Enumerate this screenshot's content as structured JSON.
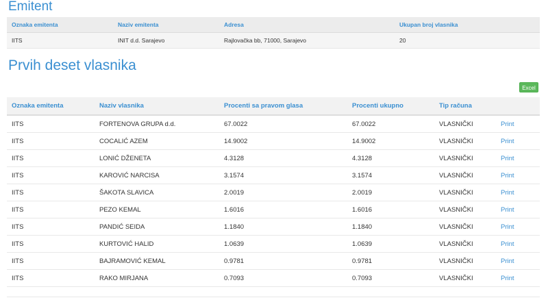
{
  "emitent": {
    "title": "Emitent",
    "headers": [
      "Oznaka emitenta",
      "Naziv emitenta",
      "Adresa",
      "Ukupan broj vlasnika"
    ],
    "row": [
      "IITS",
      "INIT d.d. Sarajevo",
      "Rajlovačka bb, 71000, Sarajevo",
      "20"
    ]
  },
  "owners": {
    "title": "Prvih deset vlasnika",
    "excel_label": "Excel",
    "headers": [
      "Oznaka emitenta",
      "Naziv vlasnika",
      "Procenti sa pravom glasa",
      "Procenti ukupno",
      "Tip računa",
      ""
    ],
    "print_label": "Print",
    "rows": [
      [
        "IITS",
        "FORTENOVA GRUPA d.d.",
        "67.0022",
        "67.0022",
        "VLASNIČKI"
      ],
      [
        "IITS",
        "COCALIĆ AZEM",
        "14.9002",
        "14.9002",
        "VLASNIČKI"
      ],
      [
        "IITS",
        "LONIĆ DŽENETA",
        "4.3128",
        "4.3128",
        "VLASNIČKI"
      ],
      [
        "IITS",
        "KAROVIĆ NARCISA",
        "3.1574",
        "3.1574",
        "VLASNIČKI"
      ],
      [
        "IITS",
        "ŠAKOTA SLAVICA",
        "2.0019",
        "2.0019",
        "VLASNIČKI"
      ],
      [
        "IITS",
        "PEZO KEMAL",
        "1.6016",
        "1.6016",
        "VLASNIČKI"
      ],
      [
        "IITS",
        "PANDIĆ SEIDA",
        "1.1840",
        "1.1840",
        "VLASNIČKI"
      ],
      [
        "IITS",
        "KURTOVIĆ HALID",
        "1.0639",
        "1.0639",
        "VLASNIČKI"
      ],
      [
        "IITS",
        "BAJRAMOVIĆ KEMAL",
        "0.9781",
        "0.9781",
        "VLASNIČKI"
      ],
      [
        "IITS",
        "RAKO MIRJANA",
        "0.7093",
        "0.7093",
        "VLASNIČKI"
      ]
    ]
  }
}
